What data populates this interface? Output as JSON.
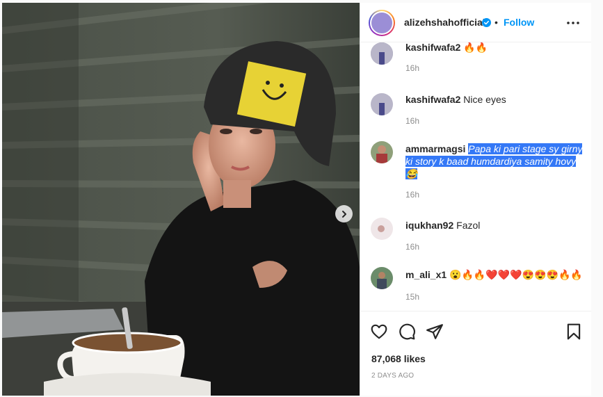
{
  "post": {
    "username": "alizehshahofficial",
    "separator": "•",
    "follow_label": "Follow",
    "media_next_icon": "chevron-right-icon"
  },
  "comments": [
    {
      "user": "kashifwafa2",
      "text": "🔥🔥",
      "time": "16h"
    },
    {
      "user": "kashifwafa2",
      "text": "Nice eyes",
      "time": "16h"
    },
    {
      "user": "ammarmagsi",
      "text": "Papa ki pari stage sy girny ki story k baad humdardiya samity hovy 😂",
      "time": "16h"
    },
    {
      "user": "iqukhan92",
      "text": "Fazol",
      "time": "16h"
    },
    {
      "user": "m_ali_x1",
      "text": "😮🔥🔥❤️❤️❤️😍😍😍🔥🔥",
      "time": "15h"
    }
  ],
  "footer": {
    "likes": "87,068 likes",
    "date": "2 DAYS AGO"
  },
  "colors": {
    "accent": "#0095f6",
    "selection": "#3478f6",
    "muted": "#8e8e8e"
  }
}
